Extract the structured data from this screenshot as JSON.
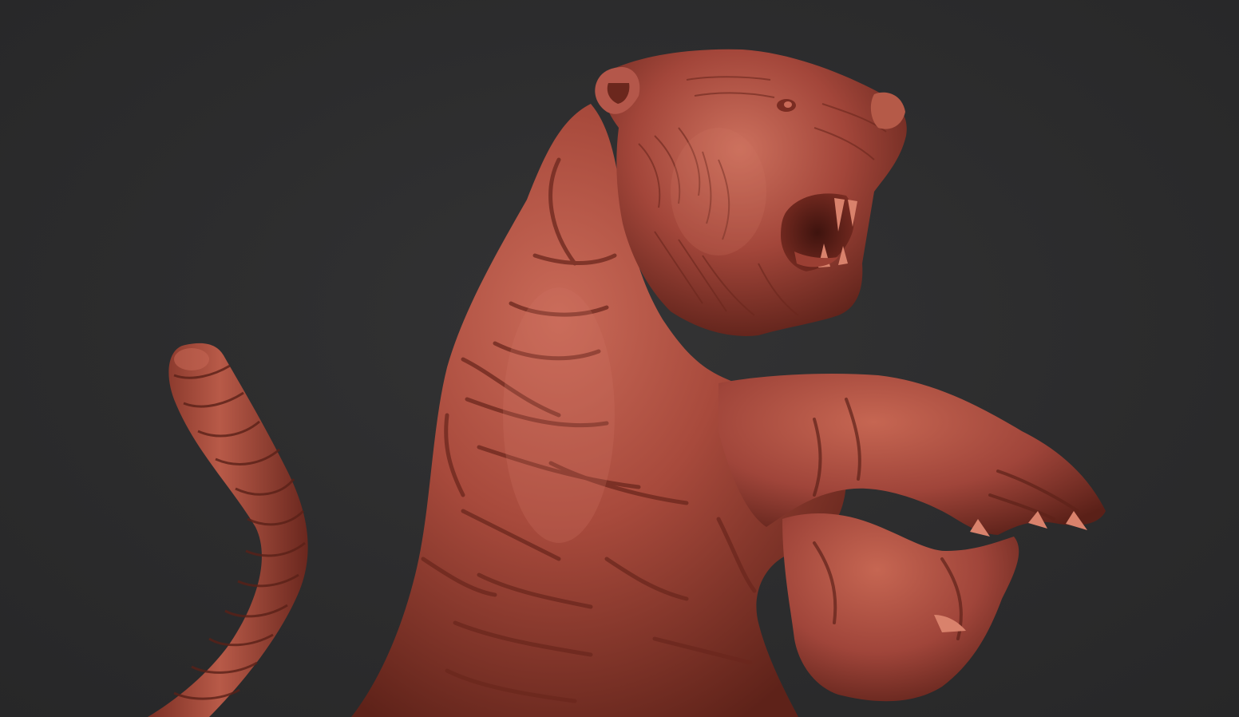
{
  "scene": {
    "background_color": "#2b2b2c",
    "material_color": "#a84a3c",
    "material_highlight": "#c96a58",
    "material_shadow": "#5e2219",
    "subject": "tiger-sculpt"
  }
}
